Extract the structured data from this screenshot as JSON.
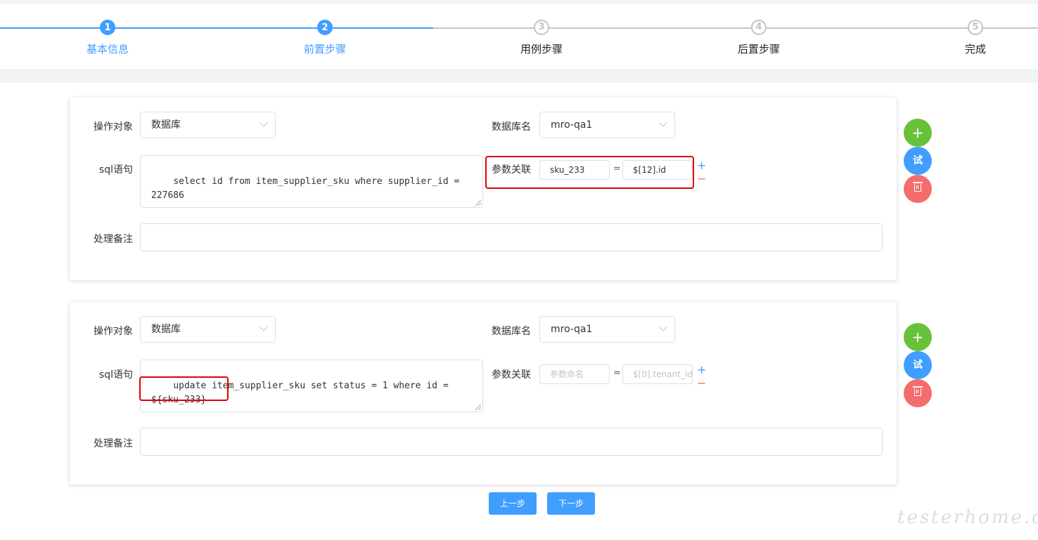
{
  "steps": [
    {
      "num": "1",
      "label": "基本信息",
      "state": "done"
    },
    {
      "num": "2",
      "label": "前置步骤",
      "state": "active"
    },
    {
      "num": "3",
      "label": "用例步骤",
      "state": "todo"
    },
    {
      "num": "4",
      "label": "后置步骤",
      "state": "todo"
    },
    {
      "num": "5",
      "label": "完成",
      "state": "todo"
    }
  ],
  "colors": {
    "primary": "#409eff",
    "success": "#67c23a",
    "danger": "#f56c6c",
    "highlight": "#e00000"
  },
  "labels": {
    "operation_target": "操作对象",
    "db_name": "数据库名",
    "sql": "sql语句",
    "param_link": "参数关联",
    "remark": "处理备注"
  },
  "cards": [
    {
      "operation_target": "数据库",
      "db_name": "mro-qa1",
      "sql": "select id from item_supplier_sku where supplier_id = 227686",
      "param_name": "sku_233",
      "param_value": "$[12].id",
      "remark": ""
    },
    {
      "operation_target": "数据库",
      "db_name": "mro-qa1",
      "sql": "update item_supplier_sku set status = 1 where id = ${sku_233}",
      "param_name_placeholder": "参数命名",
      "param_value_placeholder": "$[0].tenant_id",
      "remark": ""
    }
  ],
  "symbols": {
    "equals": "=",
    "plus": "+",
    "minus": "−",
    "add": "+",
    "try": "试",
    "delete_icon": "trash-icon"
  },
  "nav": {
    "prev": "上一步",
    "next": "下一步"
  },
  "watermark": "testerhome.com"
}
